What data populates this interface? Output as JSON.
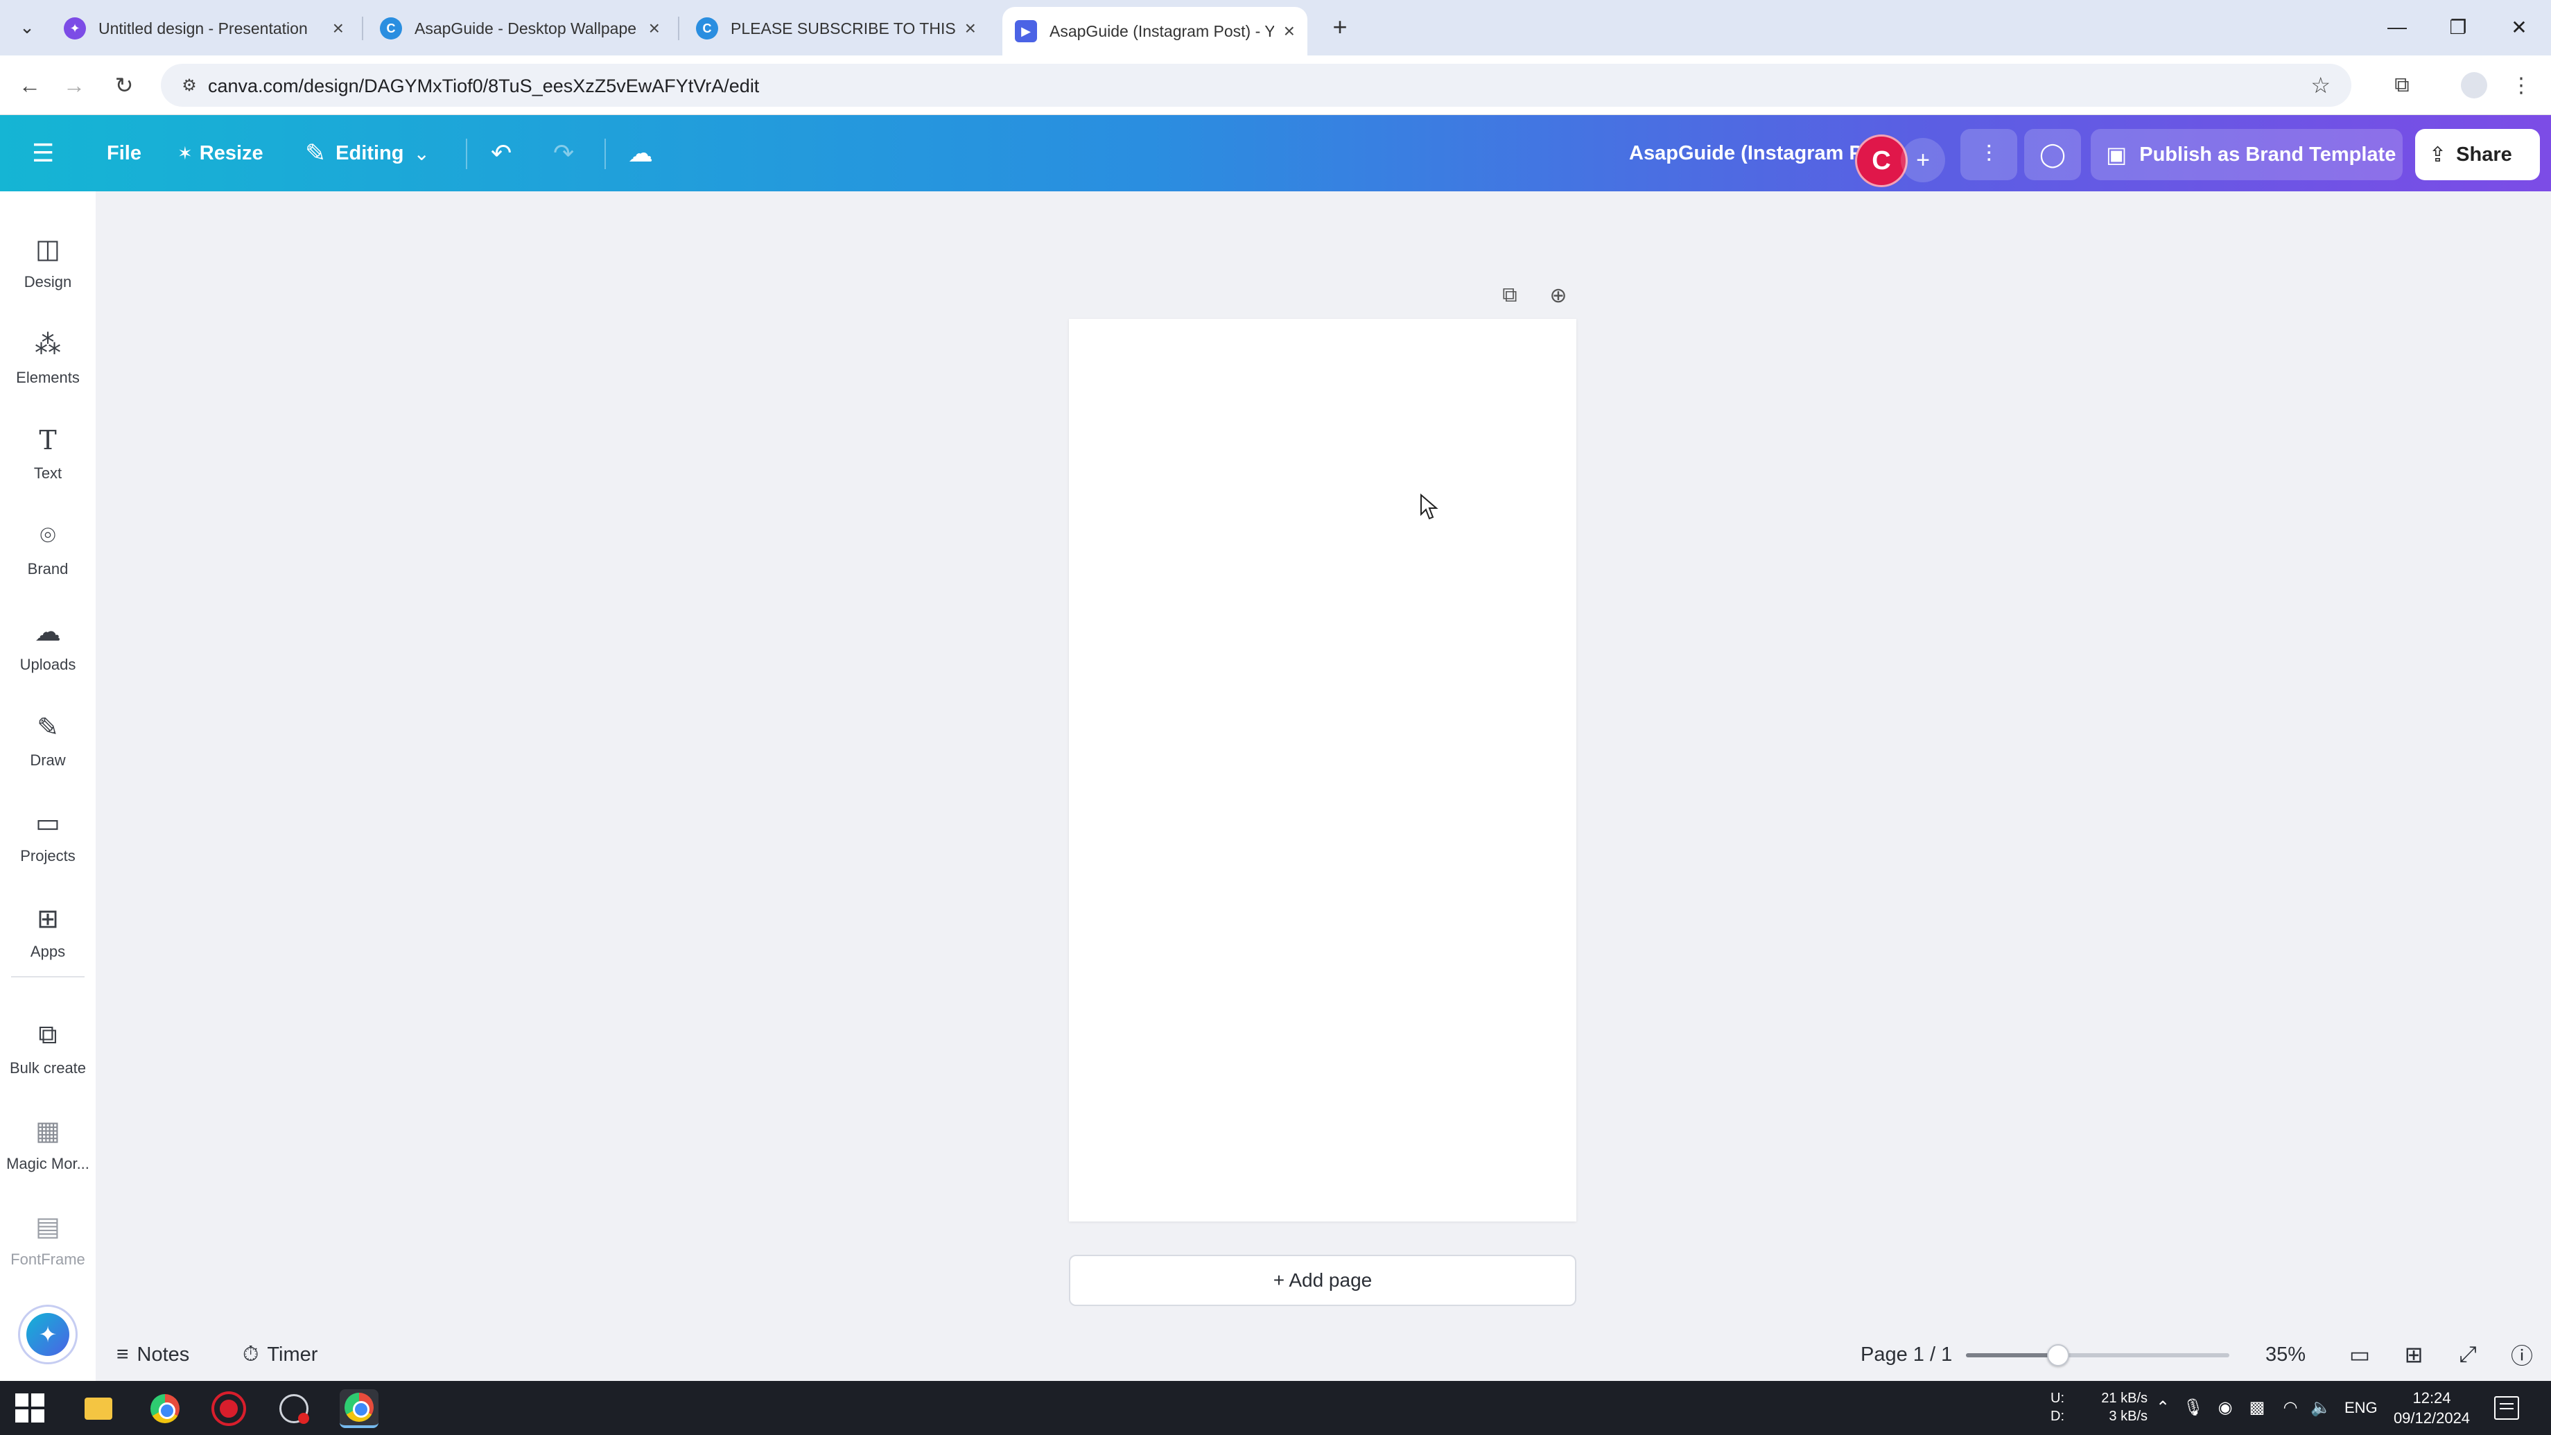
{
  "browser": {
    "tabs": [
      {
        "label": "Untitled design - Presentation",
        "favicon_color": "#7c4ce6",
        "active": false
      },
      {
        "label": "AsapGuide - Desktop Wallpape",
        "favicon_color": "#2a8ee0",
        "active": false
      },
      {
        "label": "PLEASE SUBSCRIBE TO THIS CH",
        "favicon_color": "#2a8ee0",
        "active": false
      },
      {
        "label": "AsapGuide (Instagram Post) - Y",
        "favicon_color": "#4b63e5",
        "active": true
      }
    ],
    "new_tab_glyph": "+",
    "url": "canva.com/design/DAGYMxTiof0/8TuS_eesXzZ5vEwAFYtVrA/edit"
  },
  "canva_toolbar": {
    "file_label": "File",
    "resize_label": "Resize",
    "editing_label": "Editing",
    "design_title": "AsapGuide (Instagram Post)",
    "avatar_letter": "C",
    "publish_label": "Publish as Brand Template",
    "share_label": "Share",
    "gradient_colors": [
      "#15b5d4",
      "#2a8ee0",
      "#7c4ce6"
    ]
  },
  "sidebar": {
    "items": [
      {
        "label": "Design",
        "icon": "layout-icon"
      },
      {
        "label": "Elements",
        "icon": "shapes-icon"
      },
      {
        "label": "Text",
        "icon": "text-t-icon"
      },
      {
        "label": "Brand",
        "icon": "brand-icon"
      },
      {
        "label": "Uploads",
        "icon": "cloud-upload-icon"
      },
      {
        "label": "Draw",
        "icon": "pen-icon"
      },
      {
        "label": "Projects",
        "icon": "folder-icon"
      },
      {
        "label": "Apps",
        "icon": "apps-grid-icon"
      },
      {
        "label": "Bulk create",
        "icon": "bulk-create-icon"
      },
      {
        "label": "Magic Mor...",
        "icon": "magic-morph-icon"
      },
      {
        "label": "FontFrame",
        "icon": "fontframe-icon"
      }
    ]
  },
  "canvas": {
    "add_page_label": "+ Add page"
  },
  "bottom_bar": {
    "notes_label": "Notes",
    "timer_label": "Timer",
    "page_indicator": "Page 1 / 1",
    "zoom_label": "35%",
    "zoom_fraction": 0.35
  },
  "taskbar": {
    "net_labels": [
      "U:",
      "D:"
    ],
    "net_speeds": [
      "21 kB/s",
      "3 kB/s"
    ],
    "language": "ENG",
    "time": "12:24",
    "date": "09/12/2024"
  }
}
